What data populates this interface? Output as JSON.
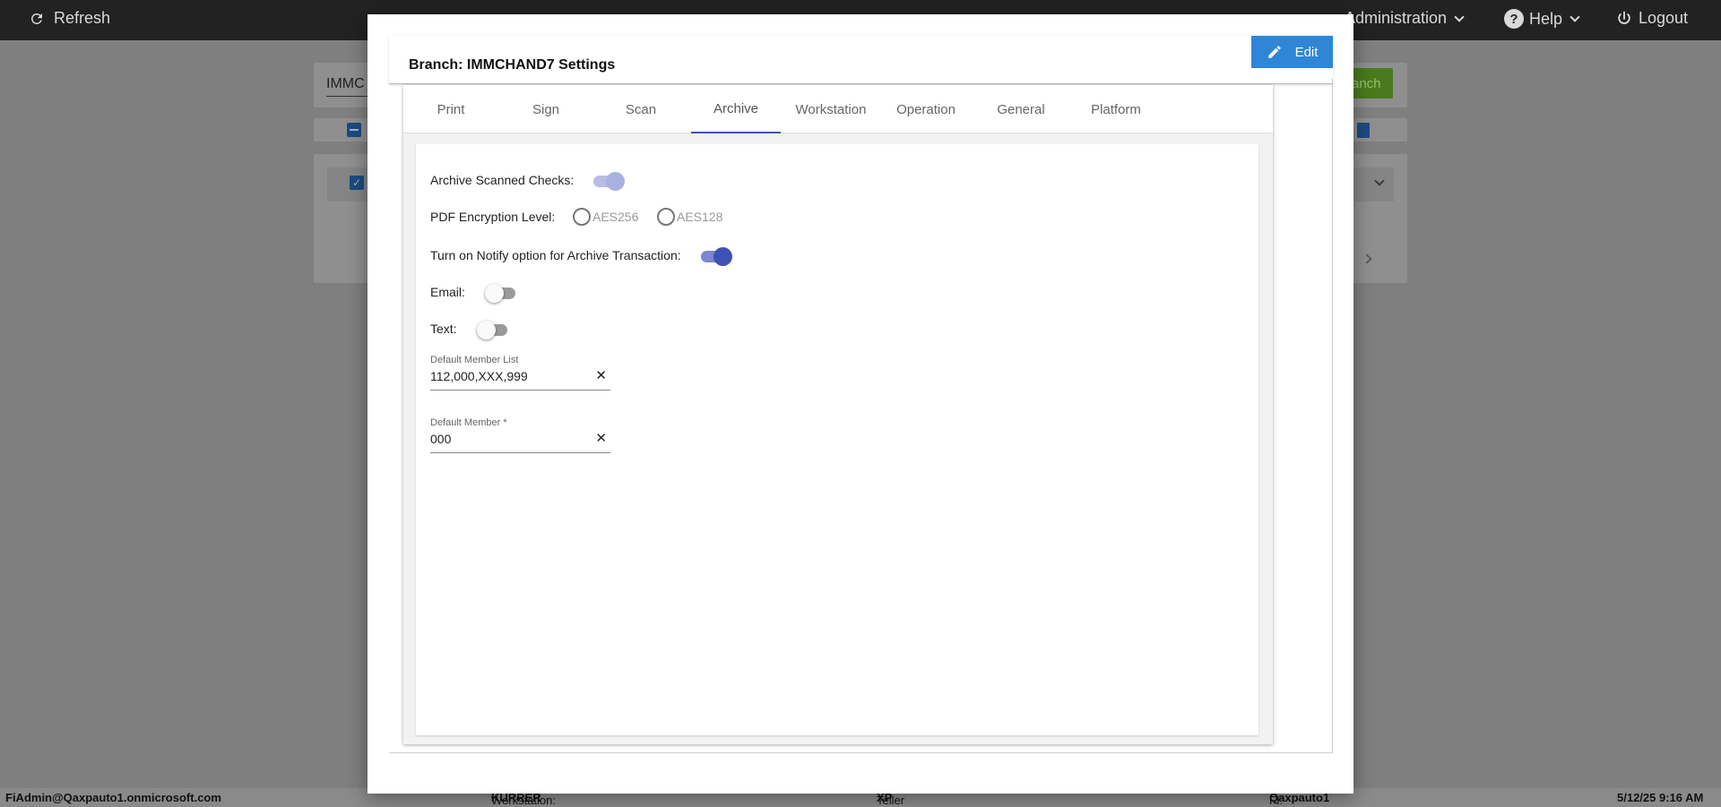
{
  "topbar": {
    "refresh_label": "Refresh",
    "administration_label": "Administration",
    "help_label": "Help",
    "logout_label": "Logout"
  },
  "background": {
    "search_value": "IMMC",
    "branch_button_label": "anch"
  },
  "footer": {
    "user": "FiAdmin@Qaxpauto1.onmicrosoft.com",
    "workstation_label": "Workstation:",
    "workstation_value": "KURRER",
    "teller_platform_label": "Teller Platform:",
    "teller_platform_value": "XP",
    "fi_label": "FI:",
    "fi_value": "Qaxpauto1",
    "datetime": "5/12/25 9:16 AM"
  },
  "modal": {
    "title": "Branch: IMMCHAND7 Settings",
    "edit_label": "Edit",
    "tabs": [
      {
        "label": "Print"
      },
      {
        "label": "Sign"
      },
      {
        "label": "Scan"
      },
      {
        "label": "Archive",
        "active": true
      },
      {
        "label": "Workstation"
      },
      {
        "label": "Operation"
      },
      {
        "label": "General"
      },
      {
        "label": "Platform"
      }
    ],
    "archive": {
      "archive_scanned_checks_label": "Archive Scanned Checks:",
      "archive_scanned_checks_on": true,
      "pdf_encryption_label": "PDF Encryption Level:",
      "pdf_options": [
        "AES256",
        "AES128"
      ],
      "pdf_selected": null,
      "notify_label": "Turn on Notify option for Archive Transaction:",
      "notify_on": true,
      "email_label": "Email:",
      "email_on": false,
      "text_label": "Text:",
      "text_on": false,
      "default_member_list_label": "Default Member List",
      "default_member_list_value": "112,000,XXX,999",
      "default_member_label": "Default Member *",
      "default_member_value": "000",
      "clear_glyph": "✕"
    }
  },
  "colors": {
    "primary": "#3f51b5",
    "edit_button": "#2f86d6",
    "topbar": "#222222"
  }
}
